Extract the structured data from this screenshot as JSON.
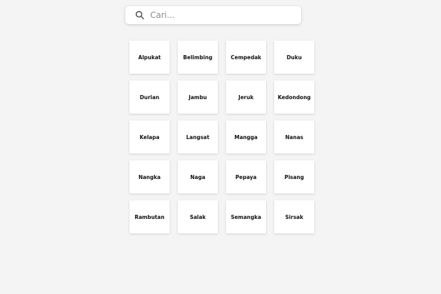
{
  "search": {
    "placeholder": "Cari..."
  },
  "fruits": [
    "Alpukat",
    "Belimbing",
    "Cempedak",
    "Duku",
    "Durian",
    "Jambu",
    "Jeruk",
    "Kedondong",
    "Kelapa",
    "Langsat",
    "Mangga",
    "Nanas",
    "Nangka",
    "Naga",
    "Pepaya",
    "Pisang",
    "Rambutan",
    "Salak",
    "Semangka",
    "Sirsak"
  ]
}
